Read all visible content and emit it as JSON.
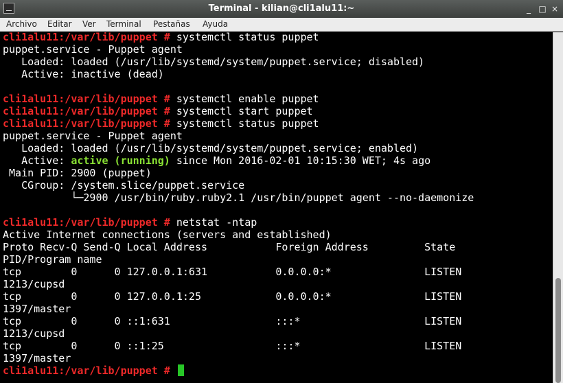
{
  "window": {
    "title": "Terminal - kilian@cli1alu11:~",
    "buttons": [
      "_",
      "□",
      "×"
    ]
  },
  "menu": [
    "Archivo",
    "Editar",
    "Ver",
    "Terminal",
    "Pestañas",
    "Ayuda"
  ],
  "terminal": {
    "prompt": "cli1alu11:/var/lib/puppet #",
    "lines": [
      {
        "cmd": "systemctl status puppet"
      },
      {
        "text": "puppet.service - Puppet agent"
      },
      {
        "text": "   Loaded: loaded (/usr/lib/systemd/system/puppet.service; disabled)"
      },
      {
        "text": "   Active: inactive (dead)"
      },
      {
        "text": ""
      },
      {
        "cmd": "systemctl enable puppet"
      },
      {
        "cmd": "systemctl start puppet"
      },
      {
        "cmd": "systemctl status puppet"
      },
      {
        "text": "puppet.service - Puppet agent"
      },
      {
        "text": "   Loaded: loaded (/usr/lib/systemd/system/puppet.service; enabled)"
      },
      {
        "pre": "   Active: ",
        "green": "active (running)",
        "post": " since Mon 2016-02-01 10:15:30 WET; 4s ago"
      },
      {
        "text": " Main PID: 2900 (puppet)"
      },
      {
        "text": "   CGroup: /system.slice/puppet.service"
      },
      {
        "text": "           └─2900 /usr/bin/ruby.ruby2.1 /usr/bin/puppet agent --no-daemonize"
      },
      {
        "text": ""
      },
      {
        "cmd": "netstat -ntap"
      },
      {
        "text": "Active Internet connections (servers and established)"
      },
      {
        "text": "Proto Recv-Q Send-Q Local Address           Foreign Address         State"
      },
      {
        "text": "PID/Program name"
      },
      {
        "text": "tcp        0      0 127.0.0.1:631           0.0.0.0:*               LISTEN"
      },
      {
        "text": "1213/cupsd"
      },
      {
        "text": "tcp        0      0 127.0.0.1:25            0.0.0.0:*               LISTEN"
      },
      {
        "text": "1397/master"
      },
      {
        "text": "tcp        0      0 ::1:631                 :::*                    LISTEN"
      },
      {
        "text": "1213/cupsd"
      },
      {
        "text": "tcp        0      0 ::1:25                  :::*                    LISTEN"
      },
      {
        "text": "1397/master"
      },
      {
        "cmd": ""
      }
    ]
  },
  "scrollbar": {
    "position_fraction": 0.7,
    "visible_fraction": 0.3
  }
}
